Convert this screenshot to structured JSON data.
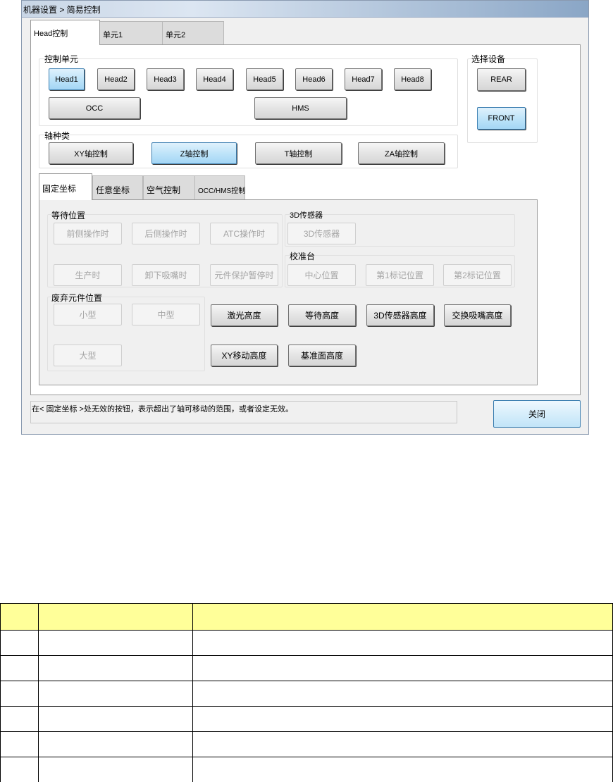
{
  "window": {
    "title": "机器设置 > 简易控制"
  },
  "top_tabs": [
    {
      "label": "Head控制",
      "active": true
    },
    {
      "label": "单元1",
      "active": false
    },
    {
      "label": "单元2",
      "active": false
    }
  ],
  "control_unit": {
    "label": "控制单元",
    "heads": [
      "Head1",
      "Head2",
      "Head3",
      "Head4",
      "Head5",
      "Head6",
      "Head7",
      "Head8"
    ],
    "selected_head": "Head1",
    "occ": "OCC",
    "hms": "HMS"
  },
  "select_device": {
    "label": "选择设备",
    "rear": "REAR",
    "front": "FRONT",
    "selected": "FRONT"
  },
  "axis_type": {
    "label": "轴种类",
    "buttons": [
      "XY轴控制",
      "Z轴控制",
      "T轴控制",
      "ZA轴控制"
    ],
    "selected": "Z轴控制"
  },
  "sub_tabs": [
    {
      "label": "固定坐标",
      "active": true
    },
    {
      "label": "任意坐标",
      "active": false
    },
    {
      "label": "空气控制",
      "active": false
    },
    {
      "label": "OCC/HMS控制",
      "active": false
    }
  ],
  "wait_position": {
    "label": "等待位置",
    "buttons": [
      "前侧操作时",
      "后侧操作时",
      "ATC操作时",
      "生产时",
      "卸下吸嘴时",
      "元件保护暂停时"
    ]
  },
  "sensor3d": {
    "label": "3D传感器",
    "button": "3D传感器"
  },
  "calib_table": {
    "label": "校准台",
    "buttons": [
      "中心位置",
      "第1标记位置",
      "第2标记位置"
    ]
  },
  "discard_position": {
    "label": "废弃元件位置",
    "buttons": [
      "小型",
      "中型",
      "大型"
    ]
  },
  "height_buttons": [
    "激光高度",
    "等待高度",
    "3D传感器高度",
    "交换吸嘴高度",
    "XY移动高度",
    "基准面高度"
  ],
  "status_text": "在< 固定坐标 >处无效的按钮，表示超出了轴可移动的范围，或者设定无效。",
  "close_button": "关闭",
  "doc_table": {
    "header": [
      "",
      "",
      ""
    ],
    "rows": [
      [
        "",
        "",
        ""
      ],
      [
        "",
        "",
        ""
      ],
      [
        "",
        "",
        ""
      ],
      [
        "",
        "",
        ""
      ],
      [
        "",
        "",
        ""
      ],
      [
        "",
        "",
        ""
      ]
    ],
    "header_color": "#ffff99"
  },
  "colors": {
    "selected_button": "#bfe4f9",
    "titlebar": "#8aa6c6"
  }
}
